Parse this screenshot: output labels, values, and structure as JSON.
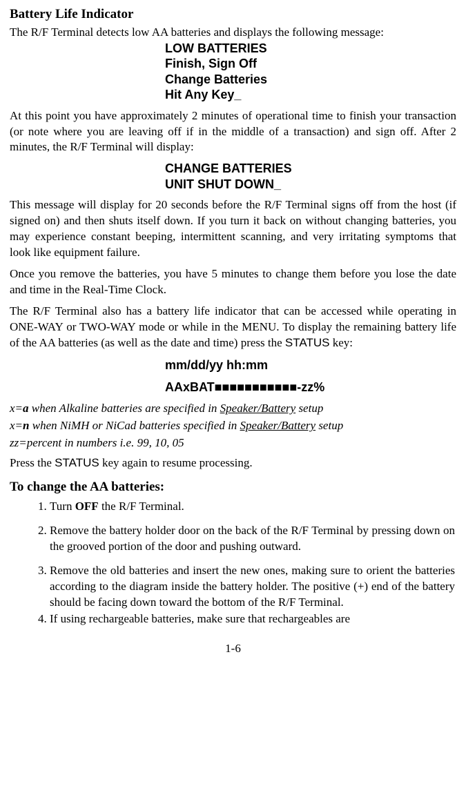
{
  "title": "Battery Life Indicator",
  "intro": "The R/F Terminal detects low AA batteries and displays the following message:",
  "display1": {
    "l1": "LOW BATTERIES",
    "l2": "Finish, Sign Off",
    "l3": "Change Batteries",
    "l4": "Hit Any Key_"
  },
  "para1": "At this point you have approximately 2 minutes of operational time to finish your transaction (or note where you are leaving off if in the middle of a transaction) and sign off.  After 2 minutes, the R/F Terminal will display:",
  "display2": {
    "l1": "CHANGE BATTERIES",
    "l2": "UNIT SHUT DOWN_"
  },
  "para2": "This message will display for 20 seconds before the R/F Terminal signs off from the host (if signed on) and then shuts itself down. If you turn it back on without changing batteries, you may experience constant beeping, intermittent scanning, and very irritating symptoms that look like equipment failure.",
  "para3": "Once you remove the batteries, you have 5 minutes to change them before you lose the date and time in the Real-Time Clock.",
  "para4_pre": "The R/F Terminal also has a battery life indicator that can be accessed while operating in ONE-WAY or TWO-WAY mode or while in the MENU.  To display the remaining battery life of the AA batteries (as well as the date and time) press the ",
  "status_key": "STATUS",
  "para4_post": " key:",
  "status_line1": "mm/dd/yy  hh:mm",
  "status_line2": "AAxBAT■■■■■■■■■■■-zz%",
  "legend": {
    "a_pre": "x=",
    "a_bold": "a",
    "a_mid": " when Alkaline batteries are specified in ",
    "a_under": "Speaker/Battery",
    "a_post": " setup",
    "n_pre": "x=",
    "n_bold": "n",
    "n_mid": " when NiMH or NiCad batteries specified in ",
    "n_under": "Speaker/Battery",
    "n_post": " setup",
    "zz": "zz=percent in numbers i.e. 99, 10, 05"
  },
  "resume_pre": "Press the ",
  "resume_post": " key again to resume processing.",
  "sub_title": "To change the AA batteries:",
  "steps": {
    "s1_pre": "Turn ",
    "s1_bold": "OFF",
    "s1_post": " the R/F Terminal.",
    "s2": "Remove the battery holder door on the back of the R/F Terminal by pressing down on the grooved portion of the door and pushing outward.",
    "s3_pre": "Remove the old batteries and insert the new ones, making sure to orient the batteries according to the diagram inside the battery holder.  The positive (",
    "s3_plus": "+",
    "s3_post": ") end of the battery should be facing down toward the bottom of the R/F Terminal.",
    "s4": "If using rechargeable batteries, make sure that rechargeables are"
  },
  "page_num": "1-6"
}
